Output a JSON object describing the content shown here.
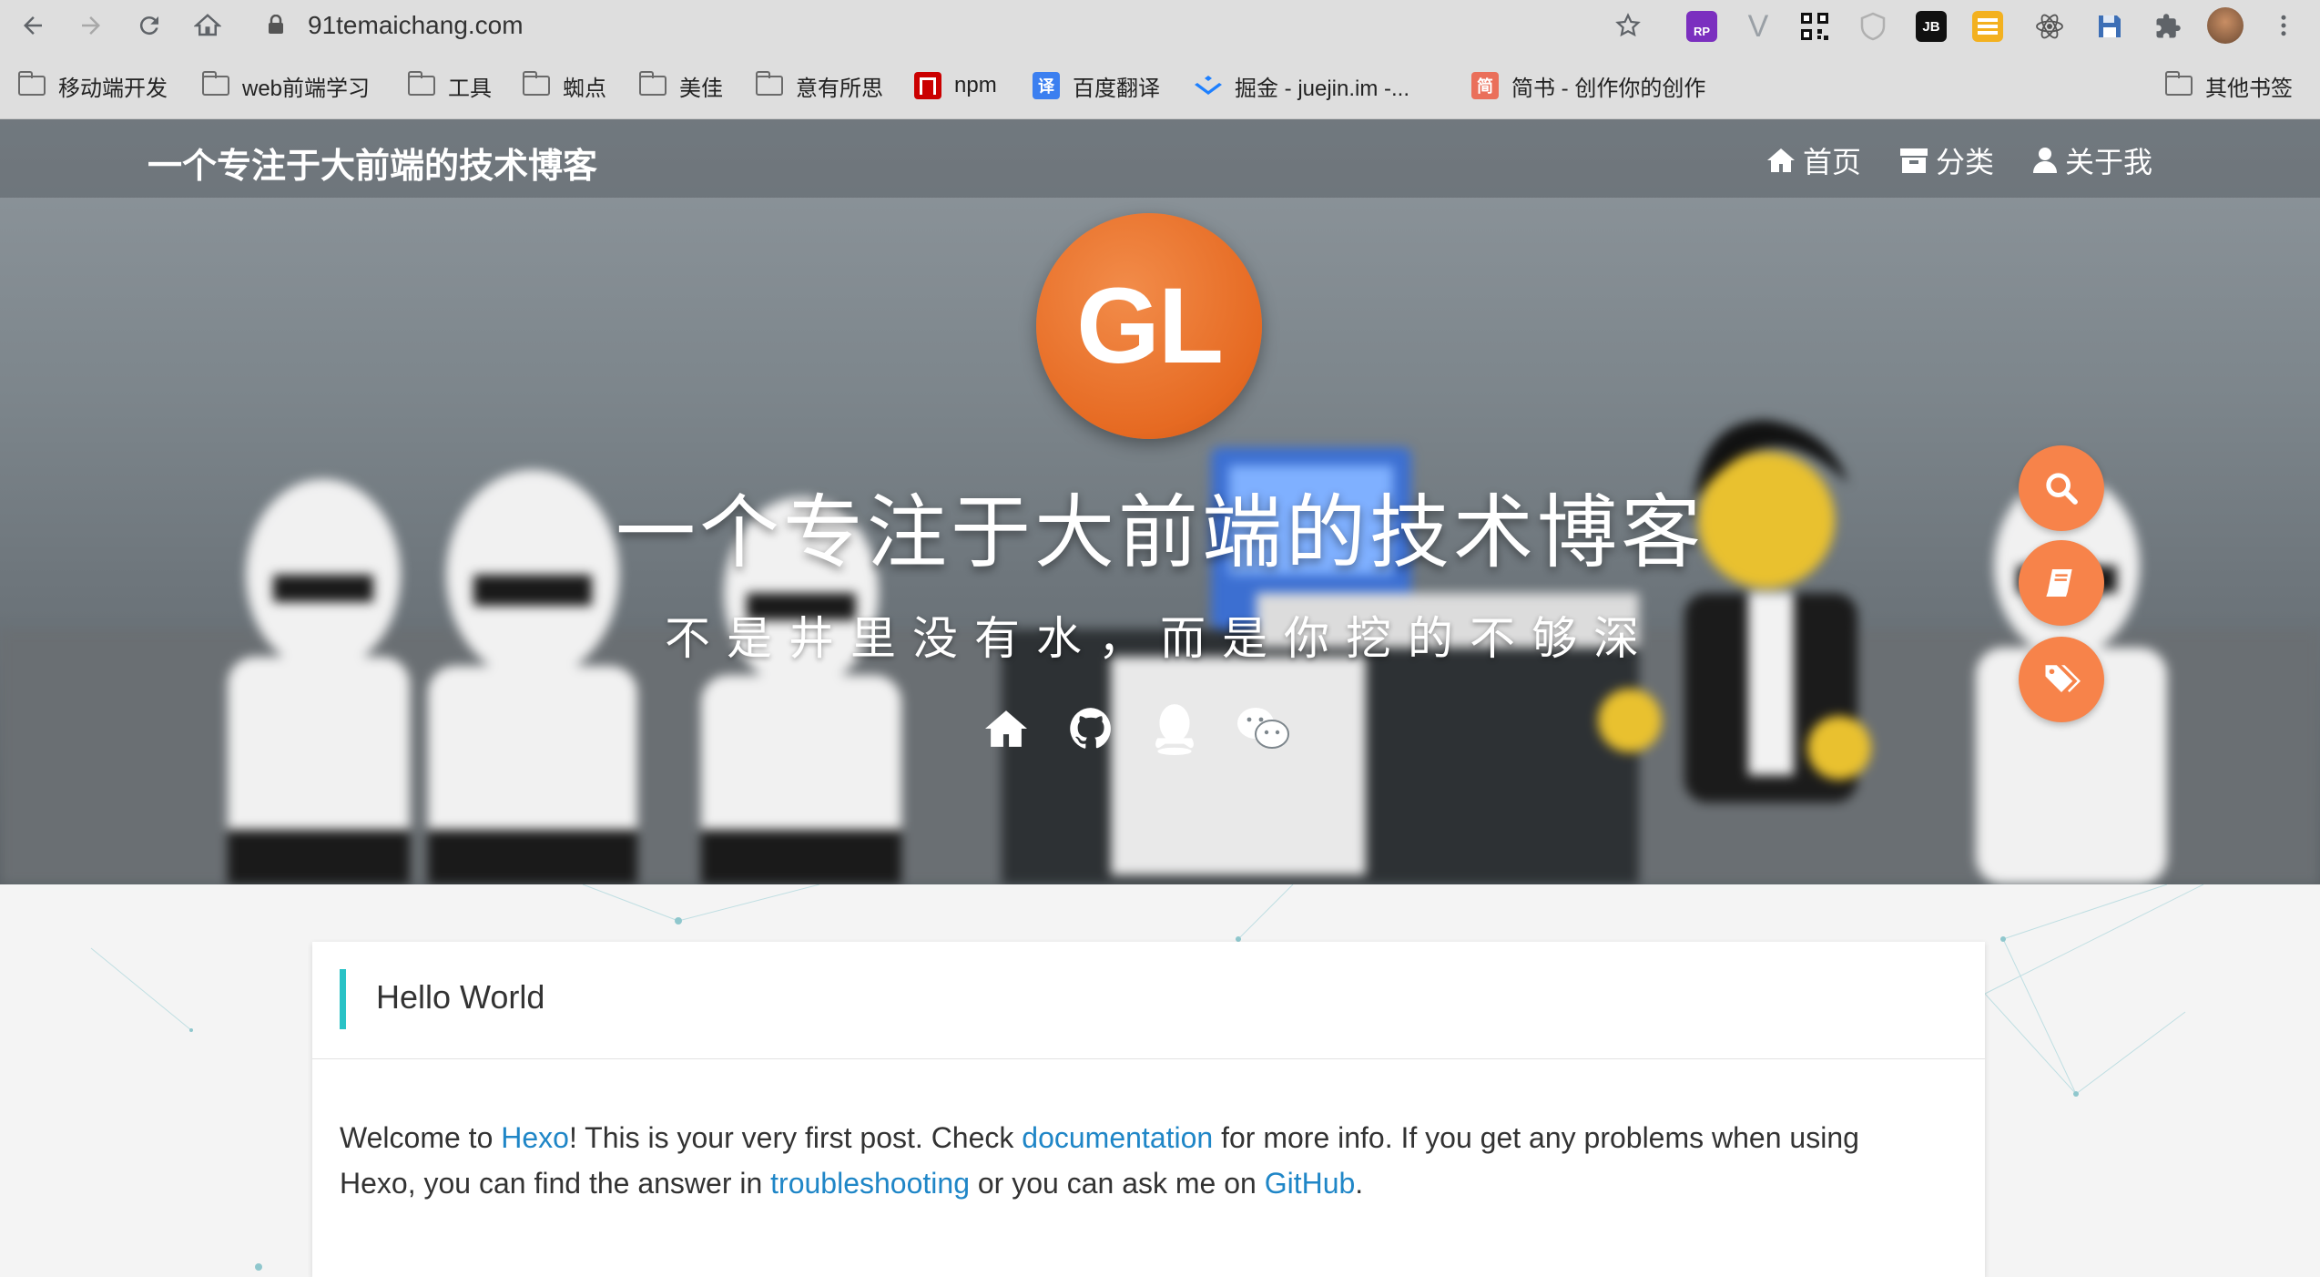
{
  "browser": {
    "url": "91temaichang.com",
    "bookmarks": [
      {
        "label": "移动端开发",
        "type": "folder"
      },
      {
        "label": "web前端学习",
        "type": "folder"
      },
      {
        "label": "工具",
        "type": "folder"
      },
      {
        "label": "蜘点",
        "type": "folder"
      },
      {
        "label": "美佳",
        "type": "folder"
      },
      {
        "label": "意有所思",
        "type": "folder"
      },
      {
        "label": "npm",
        "type": "site",
        "icon": "npm-icon",
        "color": "#cb0000"
      },
      {
        "label": "百度翻译",
        "type": "site",
        "icon": "baidu-translate-icon",
        "color": "#3b7ff0"
      },
      {
        "label": "掘金 - juejin.im -...",
        "type": "site",
        "icon": "juejin-icon",
        "color": "#1e80ff"
      },
      {
        "label": "简书 - 创作你的创作",
        "type": "site",
        "icon": "jianshu-icon",
        "color": "#ea6f5a"
      }
    ],
    "other_bookmarks": "其他书签"
  },
  "blog": {
    "site_name": "一个专注于大前端的技术博客",
    "menu": [
      {
        "label": "首页",
        "icon": "home-icon"
      },
      {
        "label": "分类",
        "icon": "archive-icon"
      },
      {
        "label": "关于我",
        "icon": "user-icon"
      }
    ],
    "avatar_text": "GL",
    "hero_title": "一个专注于大前端的技术博客",
    "hero_subtitle": "不是井里没有水，而是你挖的不够深",
    "social_icons": [
      "home-icon",
      "github-icon",
      "qq-icon",
      "wechat-icon"
    ],
    "floating_buttons": [
      "search-icon",
      "book-icon",
      "tags-icon"
    ],
    "accent_color": "#f7834a"
  },
  "post": {
    "title": "Hello World",
    "body": {
      "t1": "Welcome to ",
      "link1": "Hexo",
      "t2": "! This is your very first post. Check ",
      "link2": "documentation",
      "t3": " for more info. If you get any problems when using Hexo, you can find the answer in ",
      "link3": "troubleshooting",
      "t4": " or you can ask me on ",
      "link4": "GitHub",
      "t5": "."
    },
    "accent_color": "#29c2c6",
    "link_color": "#1f86c7"
  }
}
